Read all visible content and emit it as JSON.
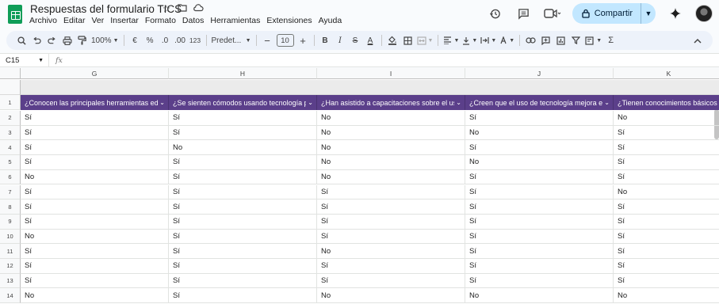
{
  "doc": {
    "title": "Respuestas del formulario TICS"
  },
  "title_icons": [
    "star-icon",
    "folder-move-icon",
    "cloud-status-icon"
  ],
  "menu": [
    "Archivo",
    "Editar",
    "Ver",
    "Insertar",
    "Formato",
    "Datos",
    "Herramientas",
    "Extensiones",
    "Ayuda"
  ],
  "share": {
    "label": "Compartir"
  },
  "toolbar": {
    "zoom": "100%",
    "currency": "€",
    "percent": "%",
    "dec_decrease": ".0",
    "dec_increase": ".00",
    "number_format": "123",
    "font": "Predet...",
    "font_size": "10",
    "bold": "B",
    "italic": "I",
    "strike": "S",
    "text_color": "A",
    "sum": "Σ"
  },
  "formula": {
    "cell_ref": "C15",
    "fx": "fx"
  },
  "columns": [
    "G",
    "H",
    "I",
    "J",
    "K"
  ],
  "header_row": {
    "row_number": "1",
    "cells": [
      "¿Conocen las principales herramientas educ",
      "¿Se sienten cómodos usando tecnología pa",
      "¿Han asistido a capacitaciones sobre el uso",
      "¿Creen que el uso de tecnología mejora el ap",
      "¿Tienen conocimientos básicos"
    ]
  },
  "rows": [
    {
      "n": "2",
      "cells": [
        "Sí",
        "Sí",
        "No",
        "Sí",
        "No"
      ]
    },
    {
      "n": "3",
      "cells": [
        "Sí",
        "Sí",
        "No",
        "No",
        "Sí"
      ]
    },
    {
      "n": "4",
      "cells": [
        "Sí",
        "No",
        "No",
        "Sí",
        "Sí"
      ]
    },
    {
      "n": "5",
      "cells": [
        "Sí",
        "Sí",
        "No",
        "No",
        "Sí"
      ]
    },
    {
      "n": "6",
      "cells": [
        "No",
        "Sí",
        "No",
        "Sí",
        "Sí"
      ]
    },
    {
      "n": "7",
      "cells": [
        "Sí",
        "Sí",
        "Sí",
        "Sí",
        "No"
      ]
    },
    {
      "n": "8",
      "cells": [
        "Sí",
        "Sí",
        "Sí",
        "Sí",
        "Sí"
      ]
    },
    {
      "n": "9",
      "cells": [
        "Sí",
        "Sí",
        "Sí",
        "Sí",
        "Sí"
      ]
    },
    {
      "n": "10",
      "cells": [
        "No",
        "Sí",
        "Sí",
        "Sí",
        "Sí"
      ]
    },
    {
      "n": "11",
      "cells": [
        "Sí",
        "Sí",
        "No",
        "Sí",
        "Sí"
      ]
    },
    {
      "n": "12",
      "cells": [
        "Sí",
        "Sí",
        "Sí",
        "Sí",
        "Sí"
      ]
    },
    {
      "n": "13",
      "cells": [
        "Sí",
        "Sí",
        "Sí",
        "Sí",
        "Sí"
      ]
    },
    {
      "n": "14",
      "cells": [
        "No",
        "Sí",
        "No",
        "No",
        "No"
      ]
    }
  ],
  "colors": {
    "header_bg": "#5b3f8a",
    "share_bg": "#c2e7ff",
    "toolbar_bg": "#edf2fa",
    "logo": "#0f9d58"
  }
}
